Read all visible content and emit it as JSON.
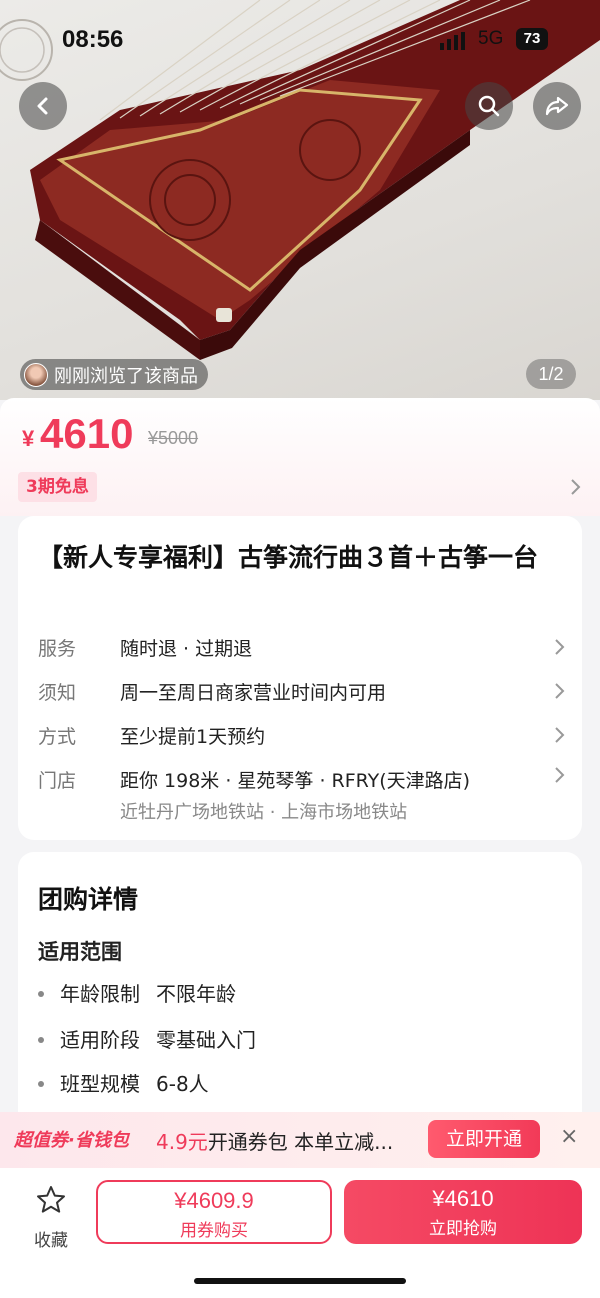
{
  "status_bar": {
    "time": "08:56",
    "network": "5G",
    "battery": "73"
  },
  "hero": {
    "viewed_text": "刚刚浏览了该商品",
    "pager": "1/2",
    "icons": [
      "back-icon",
      "search-icon",
      "share-icon"
    ]
  },
  "price": {
    "currency": "¥",
    "current": "4610",
    "original": "¥5000",
    "installment": "3期免息"
  },
  "product": {
    "title": "【新人专享福利】古筝流行曲３首＋古筝一台",
    "rows": [
      {
        "label": "服务",
        "value": "随时退 · 过期退"
      },
      {
        "label": "须知",
        "value": "周一至周日商家营业时间内可用"
      },
      {
        "label": "方式",
        "value": "至少提前1天预约"
      },
      {
        "label": "门店",
        "value": "距你 198米 · 星苑琴筝 · RFRY(天津路店)",
        "sub": "近牡丹广场地铁站 · 上海市场地铁站"
      }
    ]
  },
  "details": {
    "heading": "团购详情",
    "section": "适用范围",
    "items": [
      {
        "key": "年龄限制",
        "value": "不限年龄"
      },
      {
        "key": "适用阶段",
        "value": "零基础入门"
      },
      {
        "key": "班型规模",
        "value": "6-8人"
      }
    ]
  },
  "promo": {
    "brand": "超值券·省钱包",
    "amount": "4.9元",
    "text": "开通券包 本单立减...",
    "button": "立即开通",
    "close": "×"
  },
  "bottom_bar": {
    "favorite": "收藏",
    "coupon_price": "¥4609.9",
    "coupon_label": "用券购买",
    "buy_price": "¥4610",
    "buy_label": "立即抢购"
  },
  "colors": {
    "accent": "#ef3b5a"
  }
}
